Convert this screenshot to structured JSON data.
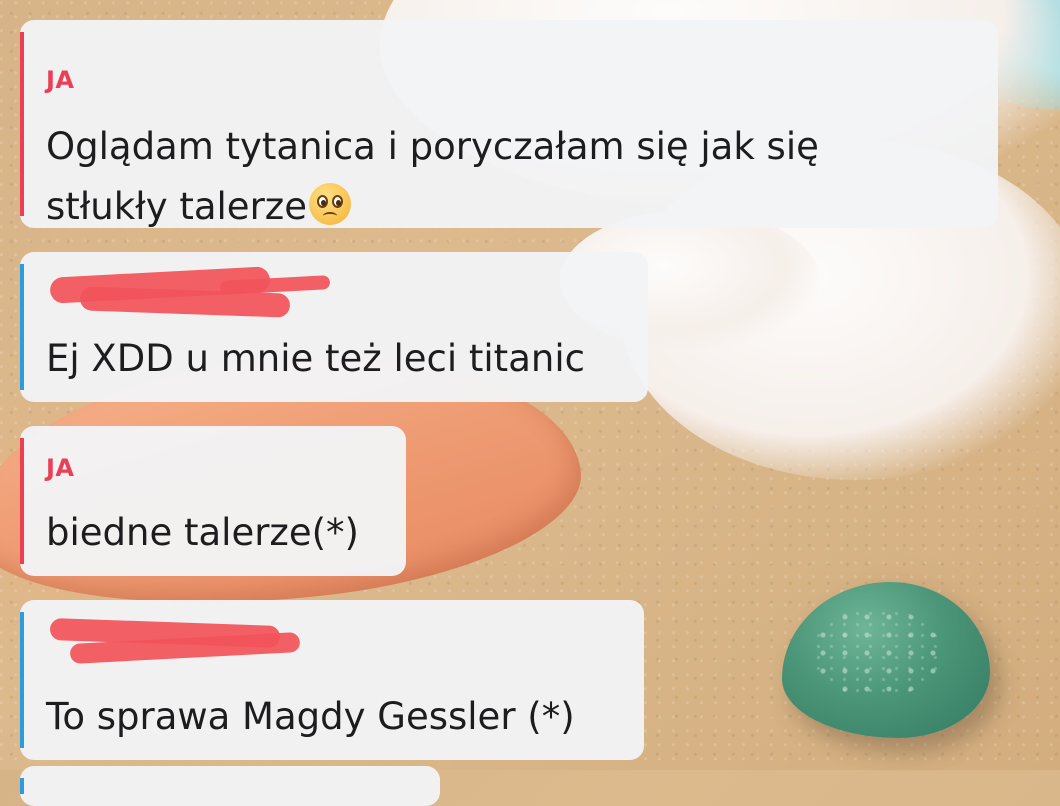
{
  "messages": [
    {
      "sender": "JA",
      "text_line1": "Oglądam tytanica i poryczałam się jak się",
      "text_line2": "stłukły talerze",
      "emoji": "pleading-face-icon"
    },
    {
      "sender": "",
      "sender_redacted": true,
      "text": "Ej XDD u mnie też leci titanic"
    },
    {
      "sender": "JA",
      "text": "biedne talerze(*)"
    },
    {
      "sender": "",
      "sender_redacted": true,
      "text": "To sprawa Magdy Gessler (*)"
    }
  ],
  "colors": {
    "me_accent": "#ec3f55",
    "friend_accent": "#2c9ce0",
    "redaction": "#f2545a"
  }
}
